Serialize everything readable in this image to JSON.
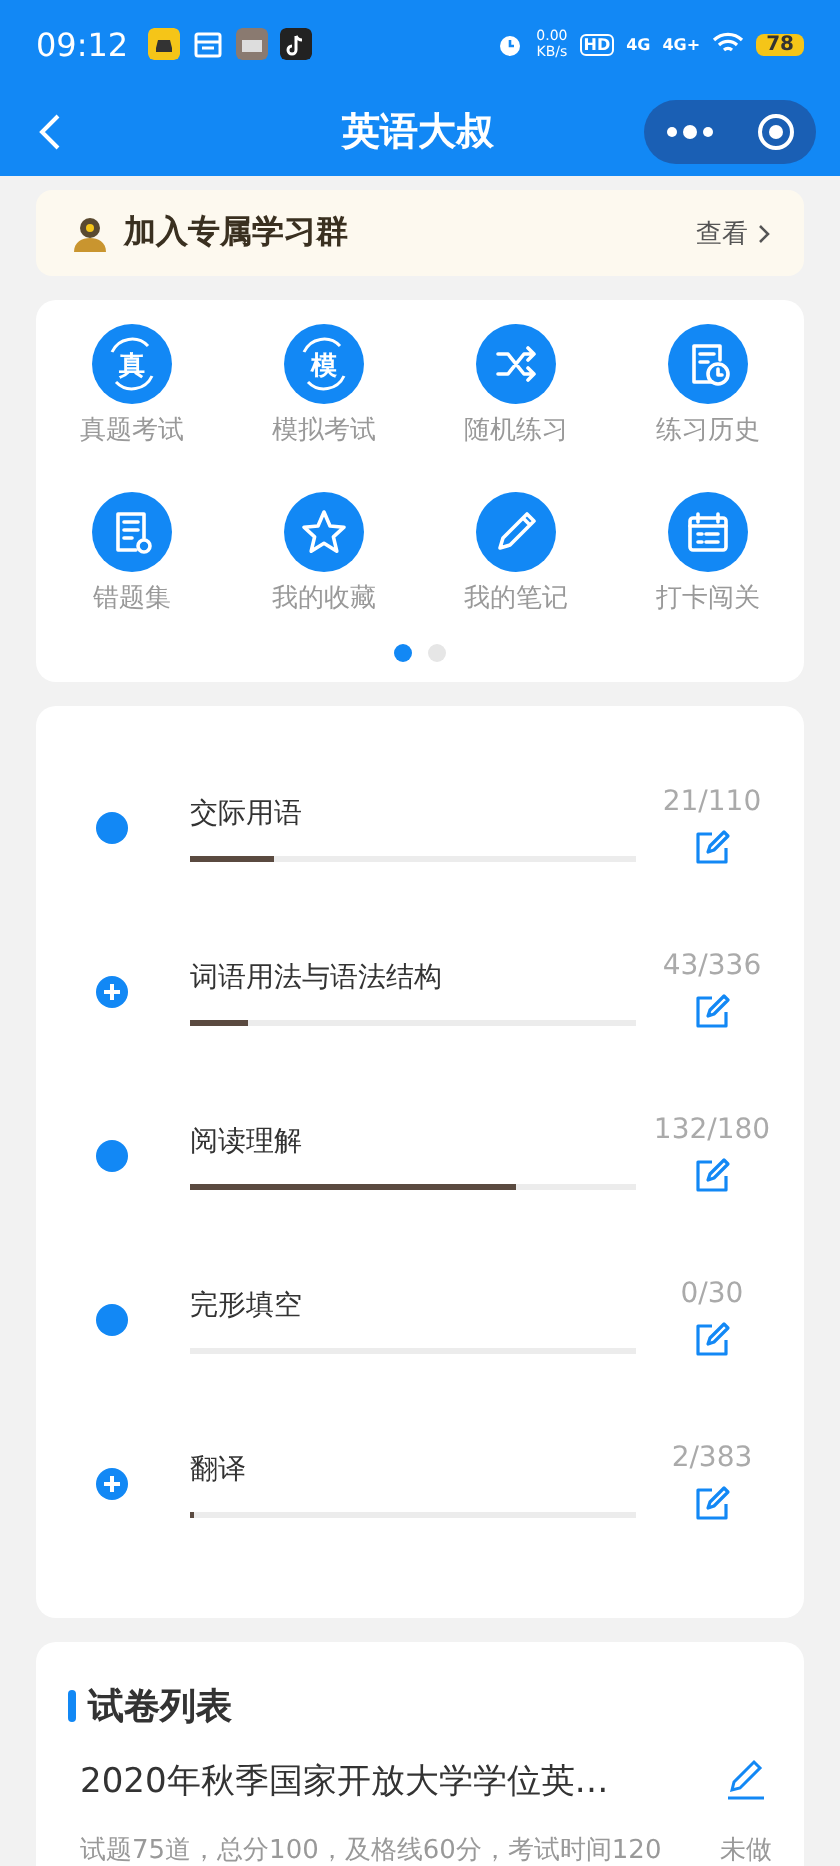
{
  "status_bar": {
    "time": "09:12",
    "net_speed": "0.00",
    "net_unit": "KB/s",
    "hd": "HD",
    "sim1": "4G",
    "sim2": "4G+",
    "battery": "78"
  },
  "nav": {
    "title": "英语大叔"
  },
  "banner": {
    "text": "加入专属学习群",
    "action": "查看"
  },
  "shortcuts": [
    {
      "kind": "glyph",
      "glyph": "真",
      "label": "真题考试"
    },
    {
      "kind": "glyph",
      "glyph": "模",
      "label": "模拟考试"
    },
    {
      "kind": "shuffle",
      "label": "随机练习"
    },
    {
      "kind": "history",
      "label": "练习历史"
    },
    {
      "kind": "mistakes",
      "label": "错题集"
    },
    {
      "kind": "star",
      "label": "我的收藏"
    },
    {
      "kind": "pencil",
      "label": "我的笔记"
    },
    {
      "kind": "calendar",
      "label": "打卡闯关"
    }
  ],
  "pager": [
    {
      "selected": true
    },
    {
      "selected": false
    }
  ],
  "topics": [
    {
      "kind": "leaf",
      "title": "交际用语",
      "count": "21/110",
      "level": 0.19
    },
    {
      "kind": "expandable",
      "title": "词语用法与语法结构",
      "count": "43/336",
      "level": 0.13
    },
    {
      "kind": "leaf",
      "title": "阅读理解",
      "count": "132/180",
      "level": 0.73
    },
    {
      "kind": "leaf",
      "title": "完形填空",
      "count": "0/30"
    },
    {
      "kind": "expandable",
      "title": "翻译",
      "count": "2/383",
      "level": 0.01
    }
  ],
  "papers": {
    "heading": "试卷列表",
    "items": [
      {
        "title": "2020年秋季国家开放大学学位英…",
        "desc": "试题75道，总分100，及格线60分，考试时间120",
        "status": "未做"
      }
    ]
  }
}
